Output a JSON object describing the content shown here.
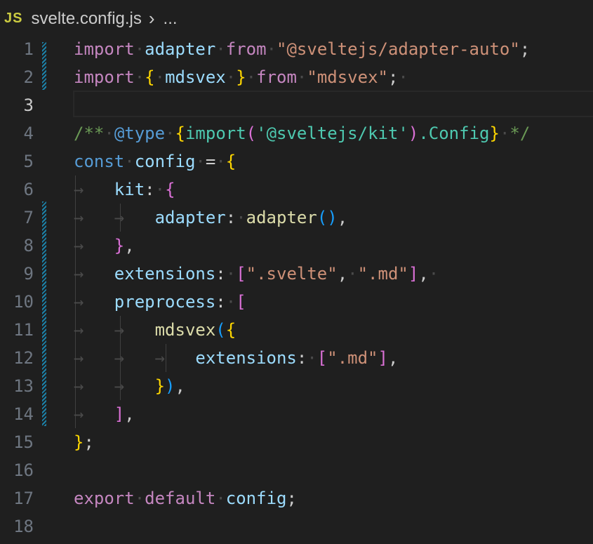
{
  "breadcrumb": {
    "file_icon": "JS",
    "file_name": "svelte.config.js",
    "separator_icon": "chevron-right-icon",
    "more": "..."
  },
  "line_numbers": [
    "1",
    "2",
    "3",
    "4",
    "5",
    "6",
    "7",
    "8",
    "9",
    "10",
    "11",
    "12",
    "13",
    "14",
    "15",
    "16",
    "17",
    "18"
  ],
  "active_line": 3,
  "lines": [
    "import adapter from \"@sveltejs/adapter-auto\";",
    "import { mdsvex } from \"mdsvex\";",
    "",
    "/** @type {import('@sveltejs/kit').Config} */",
    "const config = {",
    "  kit: {",
    "    adapter: adapter(),",
    "  },",
    "  extensions: [\".svelte\", \".md\"],",
    "  preprocess: [",
    "    mdsvex({",
    "      extensions: [\".md\"],",
    "    }),",
    "  ],",
    "};",
    "",
    "export default config;",
    ""
  ],
  "colors": {
    "background": "#1f1f1f",
    "keyword_control": "#c586c0",
    "keyword": "#569cd6",
    "variable": "#9cdcfe",
    "function": "#dcdcaa",
    "string": "#ce9178",
    "comment": "#6a9955",
    "bracket_gold": "#ffd700",
    "bracket_orchid": "#da70d6",
    "bracket_blue": "#179fff",
    "modified_gutter": "#1b81a8"
  }
}
